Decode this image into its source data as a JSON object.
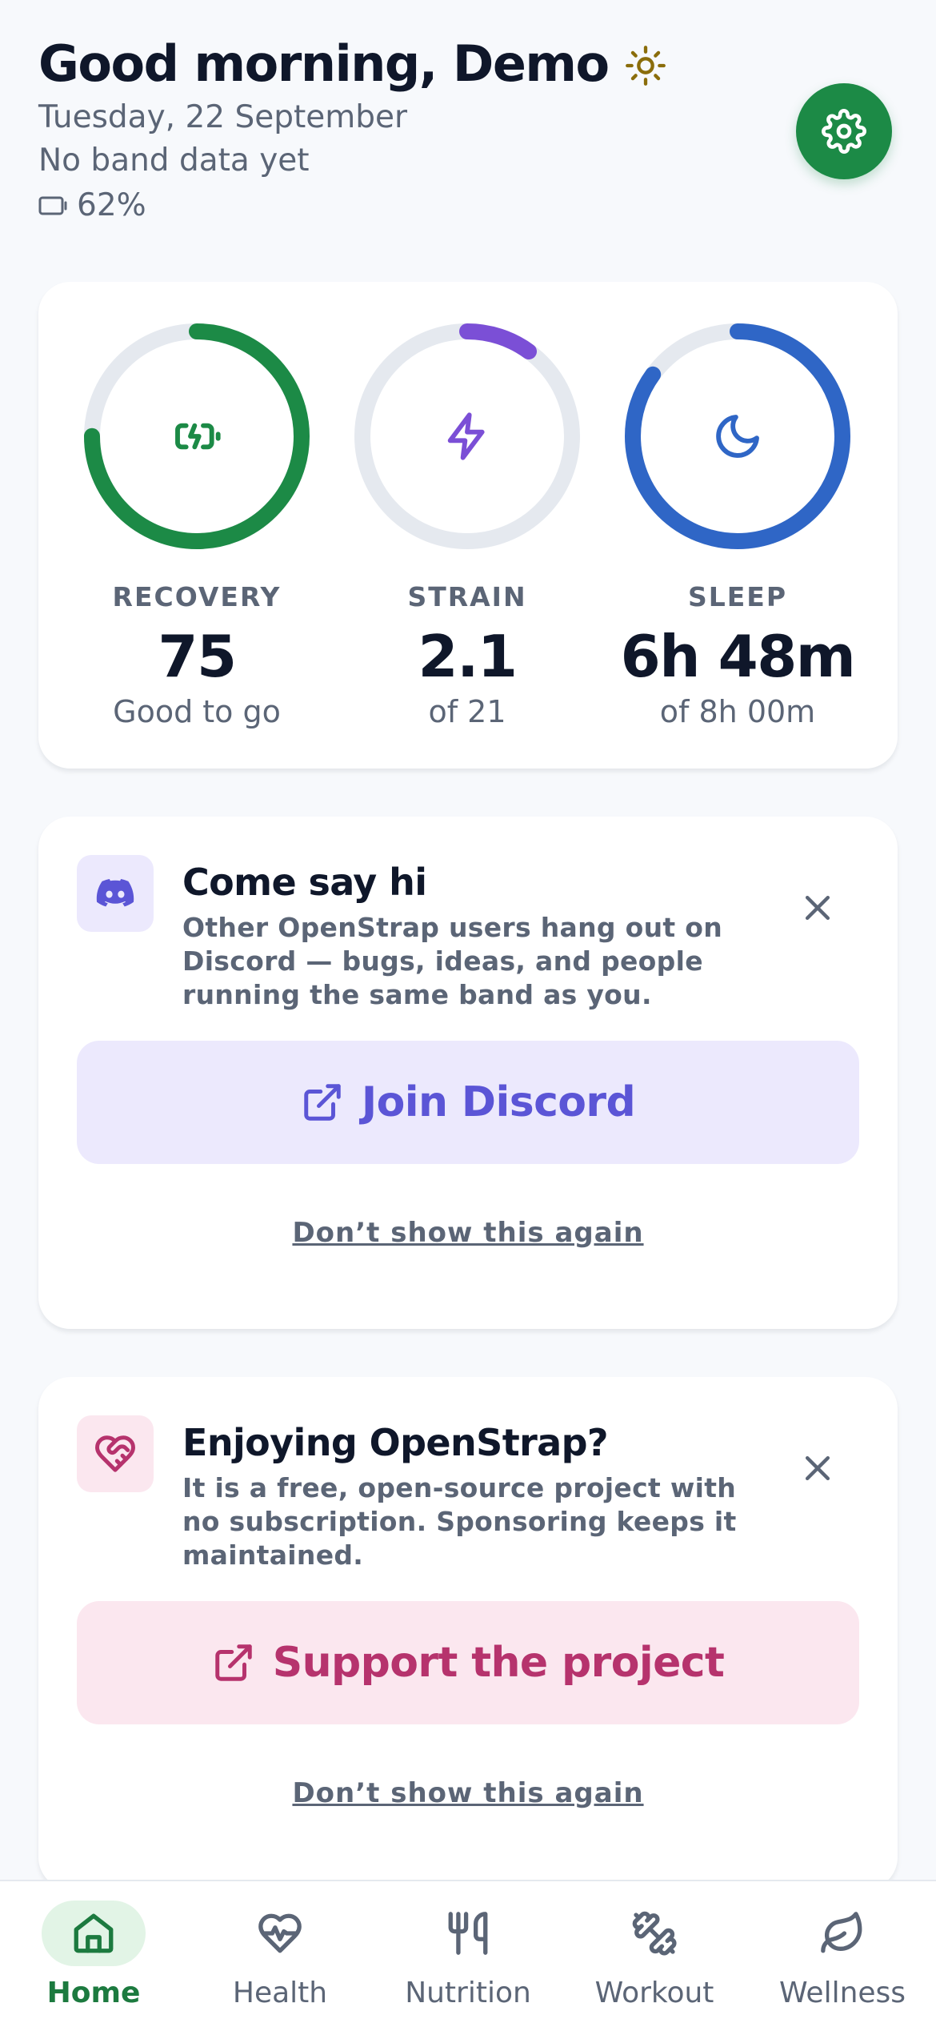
{
  "header": {
    "greeting": "Good morning, Demo",
    "date": "Tuesday, 22 September",
    "band_status": "No band data yet",
    "battery": "62%"
  },
  "metrics": [
    {
      "label": "RECOVERY",
      "value": "75",
      "sub": "Good to go",
      "progress": 0.75,
      "color": "#1c8a46",
      "icon": "battery-charging-icon"
    },
    {
      "label": "STRAIN",
      "value": "2.1",
      "sub": "of 21",
      "progress": 0.1,
      "color": "#7b4fd6",
      "icon": "lightning-icon"
    },
    {
      "label": "SLEEP",
      "value": "6h 48m",
      "sub": "of 8h 00m",
      "progress": 0.85,
      "color": "#2f66c6",
      "icon": "moon-icon"
    }
  ],
  "discord": {
    "title": "Come say hi",
    "description": "Other OpenStrap users hang out on Discord — bugs, ideas, and people running the same band as you.",
    "button": "Join Discord",
    "dismiss": "Don’t show this again",
    "accent": "#5b55d6",
    "accent_bg": "#ece9fd"
  },
  "sponsor": {
    "title": "Enjoying OpenStrap?",
    "description": "It is a free, open-source project with no subscription. Sponsoring keeps it maintained.",
    "button": "Support the project",
    "dismiss": "Don’t show this again",
    "accent": "#b6336d",
    "accent_bg": "#fbe7ef"
  },
  "nav": {
    "items": [
      {
        "label": "Home",
        "icon": "home-icon",
        "active": true
      },
      {
        "label": "Health",
        "icon": "heart-pulse-icon",
        "active": false
      },
      {
        "label": "Nutrition",
        "icon": "fork-knife-icon",
        "active": false
      },
      {
        "label": "Workout",
        "icon": "dumbbell-icon",
        "active": false
      },
      {
        "label": "Wellness",
        "icon": "leaf-icon",
        "active": false
      }
    ]
  },
  "colors": {
    "brand": "#1c8a46",
    "background": "#f7f9fc",
    "ring_track": "#e5e9ef"
  }
}
